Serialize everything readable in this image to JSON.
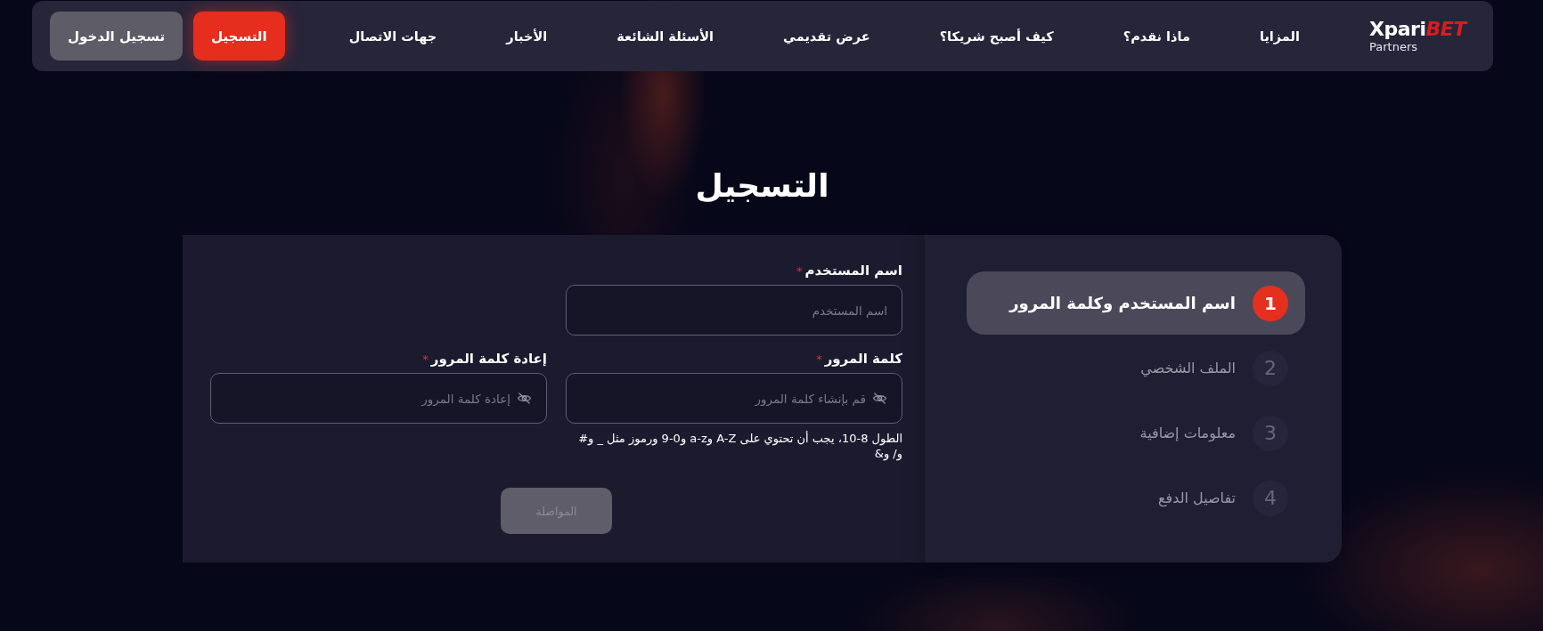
{
  "nav": {
    "logo": {
      "wordmark": "Xpari",
      "accent": "BET",
      "tagline": "Partners"
    },
    "items": [
      "المزايا",
      "ماذا نقدم؟",
      "كيف أصبح شريكا؟",
      "عرض تقديمي",
      "الأسئلة الشائعة",
      "الأخبار",
      "جهات الاتصال"
    ],
    "buttons": [
      {
        "label": "التسجيل",
        "kind": "primary"
      },
      {
        "label": "تسجيل الدخول",
        "kind": "secondary"
      }
    ]
  },
  "title": "التسجيل",
  "steps": [
    {
      "number": "1",
      "label": "اسم المستخدم وكلمة المرور",
      "selected": true
    },
    {
      "number": "2",
      "label": "الملف الشخصي",
      "selected": false
    },
    {
      "number": "3",
      "label": "معلومات إضافية",
      "selected": false
    },
    {
      "number": "4",
      "label": "تفاصيل الدفع",
      "selected": false
    }
  ],
  "form": {
    "rows": [
      {
        "fields": [
          {
            "kind": "text",
            "label": "اسم المستخدم",
            "required_mark": "*",
            "placeholder": "اسم المستخدم"
          }
        ]
      },
      {
        "fields": [
          {
            "kind": "password",
            "label": "كلمة المرور",
            "required_mark": "*",
            "placeholder": "قم بإنشاء كلمة المرور",
            "hint": "الطول 8-10، يجب أن تحتوي على A-Z وa-z و0-9 ورموز مثل _ و# و/ و&"
          },
          {
            "kind": "password",
            "label": "إعادة كلمة المرور",
            "required_mark": "*",
            "placeholder": "إعادة كلمة المرور"
          }
        ]
      }
    ],
    "submit": {
      "label": "المواصلة",
      "disabled": true
    }
  }
}
